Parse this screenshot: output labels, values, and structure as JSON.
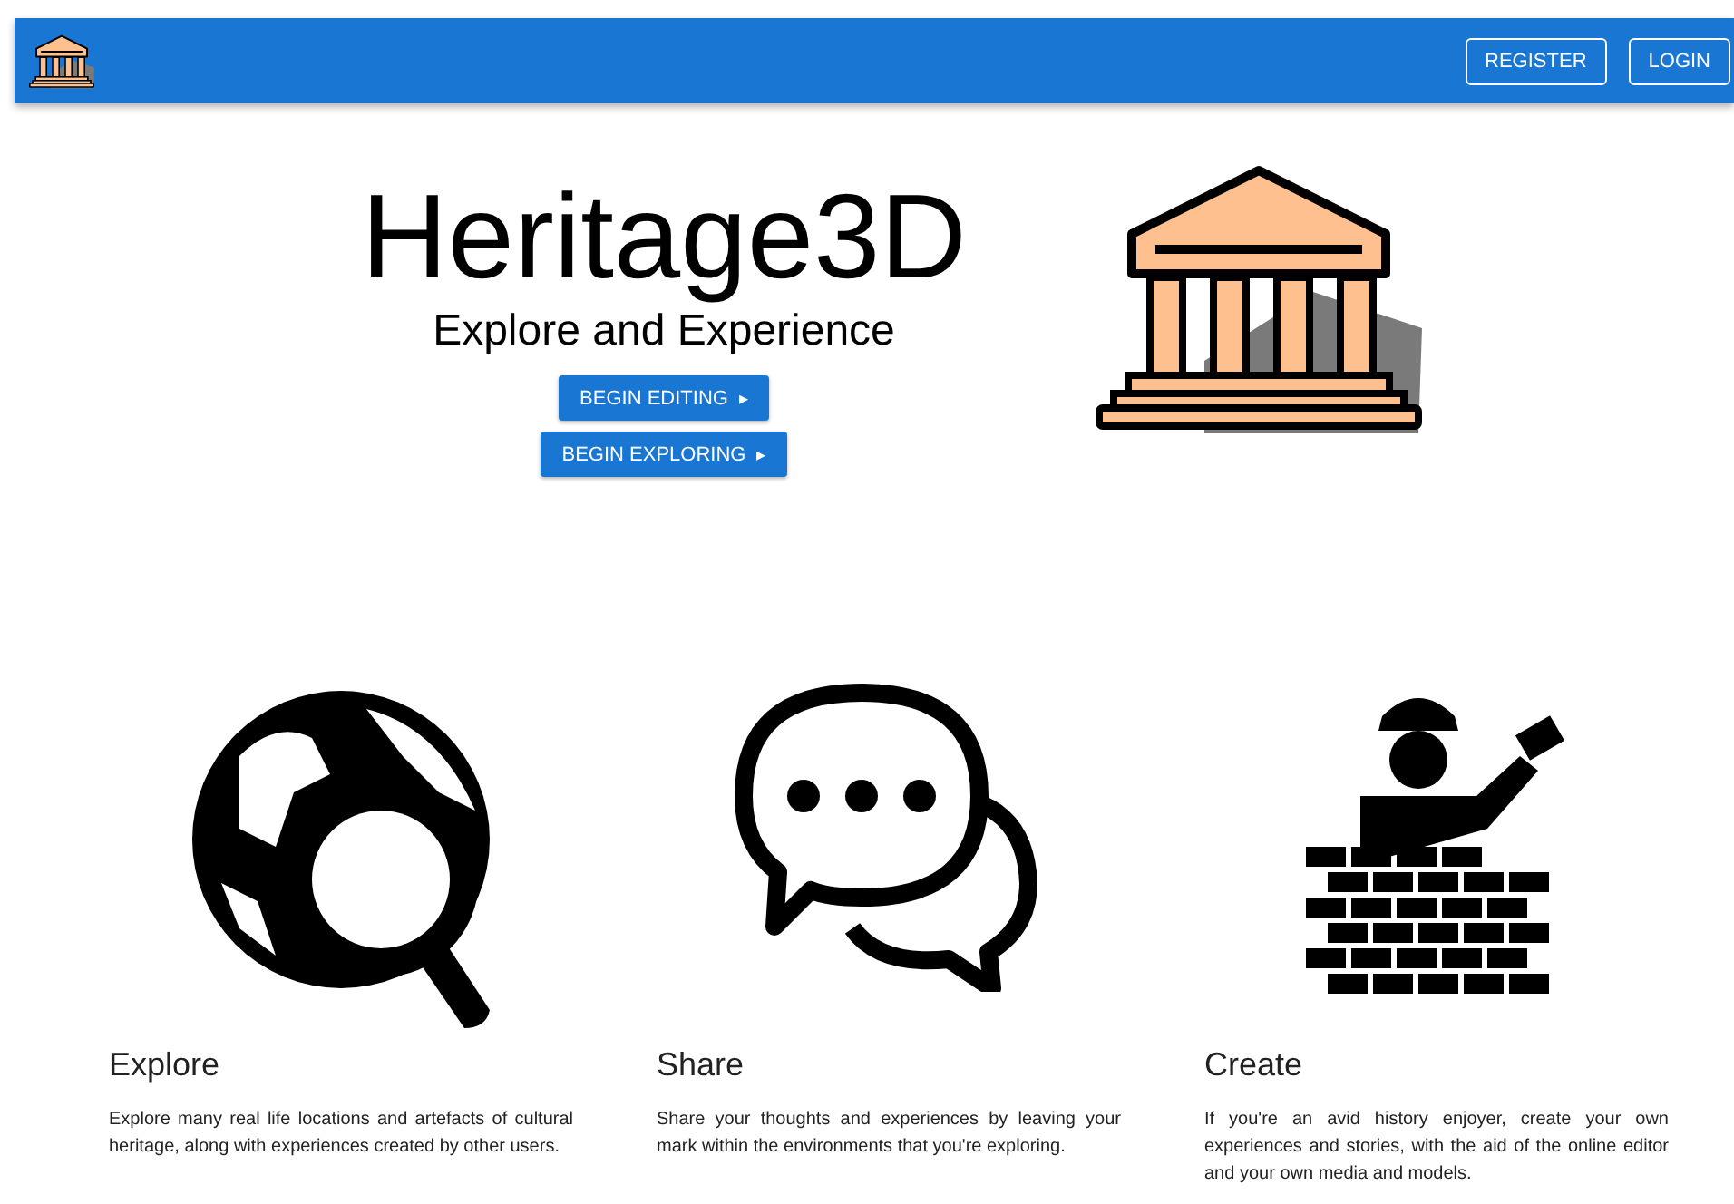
{
  "app_bar": {
    "actions": [
      "REGISTER",
      "LOGIN"
    ]
  },
  "hero": {
    "title": "Heritage3D",
    "subtitle": "Explore and Experience",
    "buttons": [
      {
        "label": "BEGIN EDITING",
        "icon": "▸"
      },
      {
        "label": "BEGIN EXPLORING",
        "icon": "▸"
      }
    ]
  },
  "features": [
    {
      "kind": "globe",
      "title": "Explore",
      "text": "Explore many real life locations and artefacts of cultural heritage, along with experiences created by other users."
    },
    {
      "kind": "chat",
      "title": "Share",
      "text": "Share your thoughts and experiences by leaving your mark within the environments that you're exploring."
    },
    {
      "kind": "builder",
      "title": "Create",
      "text": "If you're an avid history enjoyer, create your own experiences and stories, with the aid of the online editor and your own media and models."
    }
  ]
}
